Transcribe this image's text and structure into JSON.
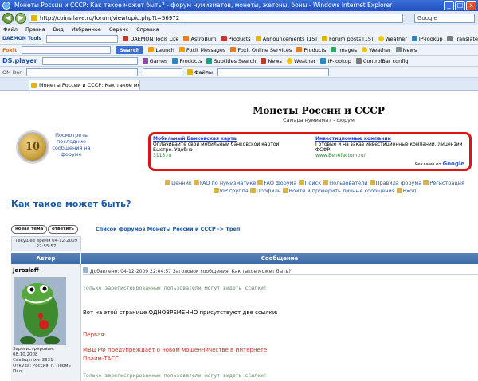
{
  "window": {
    "title": "Монеты России и СССР: Как такое может быть? - форум нумизматов, монеты, жетоны, боны - Windows Internet Explorer",
    "minimize": "_",
    "maximize": "□",
    "close": "x"
  },
  "address": {
    "url": "http://coins.lave.ru/forum/viewtopic.php?t=56972",
    "search_placeholder": "Google"
  },
  "menu": [
    "Файл",
    "Правка",
    "Вид",
    "Избранное",
    "Сервис",
    "Справка"
  ],
  "toolbar1": {
    "brand": "DAEMON Tools",
    "items": [
      "DAEMON Tools Lite",
      "AstroBurn",
      "Products",
      "Announcements [15]",
      "Forum posts [15]",
      "Weather",
      "IP-lookup",
      "Translate"
    ]
  },
  "toolbar2": {
    "brand": "Foxit",
    "search_label": "Search",
    "items": [
      "Launch",
      "Foxit Messages",
      "Foxit Online Services",
      "Products",
      "Images",
      "Weather",
      "News"
    ]
  },
  "toolbar3": {
    "brand": "DS.player",
    "items": [
      "Games",
      "Products",
      "Subtitles Search",
      "News",
      "Weather",
      "IP-lookup",
      "ControlBar config"
    ]
  },
  "toolbar4": {
    "brand": "ОМ Bar",
    "files_label": "Файлы"
  },
  "tab": {
    "label": "Монеты России и СССР: Как такое может быть?"
  },
  "site": {
    "title": "Монеты России и СССР",
    "subtitle": "Самара нумизмат - форум",
    "coin_label": "10",
    "coin_link": "Посмотреть последние сообщения на форуме"
  },
  "ads": [
    {
      "title": "Мобильный Банковская карта",
      "desc": "Оплачивайте свой мобильный банковской картой. Быстро. Удобно",
      "url": "3115.ru"
    },
    {
      "title": "Инвестиционные компании",
      "desc": "Готовые и на заказ инвестиционные компании. Лицензии ФСФР.",
      "url": "www.Benefactum.ru/"
    }
  ],
  "ads_by": "Реклама от",
  "ads_by_brand": "Google",
  "nav": {
    "row1": [
      "Ценник",
      "FAQ по нумизматике",
      "FAQ форума",
      "Поиск",
      "Пользователи",
      "Правила форума",
      "Регистрация"
    ],
    "row2": [
      "VIP группа",
      "Профиль",
      "Войти и проверить личные сообщения",
      "Вход"
    ]
  },
  "topic": {
    "title": "Как такое может быть?",
    "new_topic": "новая тема",
    "reply": "ответить",
    "breadcrumb": "Список форумов Монеты России и СССР -> Треп",
    "current_time": "Текущее время 04-12-2009 22:55:57"
  },
  "table": {
    "col_author": "Автор",
    "col_message": "Сообщение"
  },
  "post": {
    "author": "Jaroslaff",
    "registered": "Зарегистрирован: 08.10.2008",
    "messages": "Сообщения: 3331",
    "from": "Откуда: Россия, г. Пермь",
    "sex": "Пол:",
    "header": "Добавлено: 04-12-2009 22:04:57    Заголовок сообщения: Как такое может быть?",
    "notice": "Только зарегистрированные пользователи могут видеть ссылки!",
    "line1": "Вот на этой странице ОДНОВРЕМЕННО присутствуют две ссылки:",
    "first_label": "Первая:",
    "quote1": "МВД РФ предупреждает о новом мошенничестве в Интернете",
    "quote2": "Прайм-ТАСС",
    "notice2": "Только зарегистрированные пользователи могут видеть ссылки!"
  }
}
